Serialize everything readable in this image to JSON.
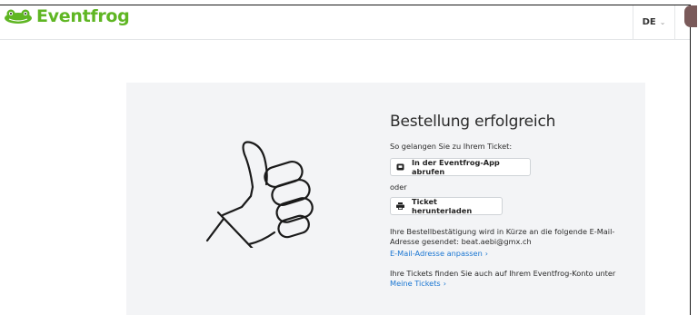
{
  "header": {
    "logo_text": "Eventfrog",
    "language": "DE",
    "brand_color": "#5fb623"
  },
  "confirmation": {
    "title": "Bestellung erfolgreich",
    "subtitle": "So gelangen Sie zu Ihrem Ticket:",
    "app_button_label": "In der Eventfrog-App abrufen",
    "or_label": "oder",
    "download_button_label": "Ticket herunterladen",
    "email_text": "Ihre Bestellbestätigung wird in Kürze an die folgende E-Mail-Adresse gesendet: beat.aebi@gmx.ch",
    "edit_email_link": "E-Mail-Adresse anpassen",
    "account_text": "Ihre Tickets finden Sie auch auf Ihrem Eventfrog-Konto unter",
    "my_tickets_link": "Meine Tickets",
    "link_color": "#1a76d2"
  },
  "icons": [
    "frog-logo-icon",
    "chevron-down-icon",
    "thumbs-up-icon",
    "mobile-app-icon",
    "printer-icon",
    "chevron-right-icon"
  ]
}
